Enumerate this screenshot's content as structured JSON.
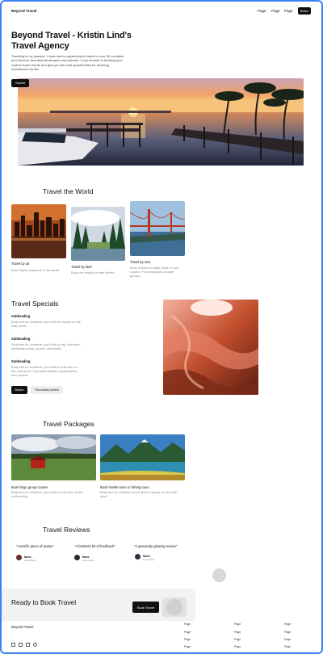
{
  "nav": {
    "brand": "Beyond Travel",
    "links": [
      "Page",
      "Page",
      "Page"
    ],
    "button": "Button"
  },
  "hero": {
    "title": "Beyond Travel - Kristin Lind's Travel Agency",
    "description": "Traveling is my passion. I have had to opportunity to travel to over 50 countries and discover beautiful landscapes and cultures. I look forward to booking your custom travel needs and give you the best opportunities for amazing experiences for life.",
    "button": "Submit"
  },
  "world": {
    "title": "Travel the World",
    "cards": [
      {
        "title": "Travel by air",
        "desc": "Book flights anywhere in the world."
      },
      {
        "title": "Travel by land",
        "desc": "Book car rentals or train tickets."
      },
      {
        "title": "Travel by Sea",
        "desc": "Book cruises on large ships or river cruises. For individuals or large groups."
      }
    ]
  },
  "specials": {
    "title": "Travel Specials",
    "items": [
      {
        "heading": "Subheading",
        "body": "Body text for whatever you'd like to expand on the main point."
      },
      {
        "heading": "Subheading",
        "body": "Body text for whatever you'd like to say. Add main takeaway points, quotes, anecdotes."
      },
      {
        "heading": "Subheading",
        "body": "Body text for whatever you'd like to add more to the main point. It provides details, explanations, and context."
      }
    ],
    "primary_button": "Button",
    "secondary_button": "Secondary button"
  },
  "packages": {
    "title": "Travel Packages",
    "cards": [
      {
        "title": "Book large group cruises",
        "desc": "Body text for whatever you'd like to add more to the subheading."
      },
      {
        "title": "Book hostile tours or fishing tours.",
        "desc": "Body text for whatever you'd like to expand on the main point."
      }
    ]
  },
  "reviews": {
    "title": "Travel Reviews",
    "items": [
      {
        "quote": "\"A terrific piece of praise\"",
        "name": "Name",
        "role": "Description"
      },
      {
        "quote": "\"A fantastic bit of feedback\"",
        "name": "Name",
        "role": "Description"
      },
      {
        "quote": "\"A genuinely glowing review\"",
        "name": "Name",
        "role": "Description"
      }
    ]
  },
  "cta": {
    "title": "Ready to Book Travel",
    "button": "Book Travel"
  },
  "footer": {
    "brand": "Beyond Travel",
    "columns": [
      [
        "Page",
        "Page",
        "Page",
        "Page"
      ],
      [
        "Page",
        "Page",
        "Page",
        "Page"
      ],
      [
        "Page",
        "Page",
        "Page",
        "Page"
      ]
    ],
    "social_icons": [
      "facebook-icon",
      "linkedin-icon",
      "youtube-icon",
      "instagram-icon"
    ]
  }
}
